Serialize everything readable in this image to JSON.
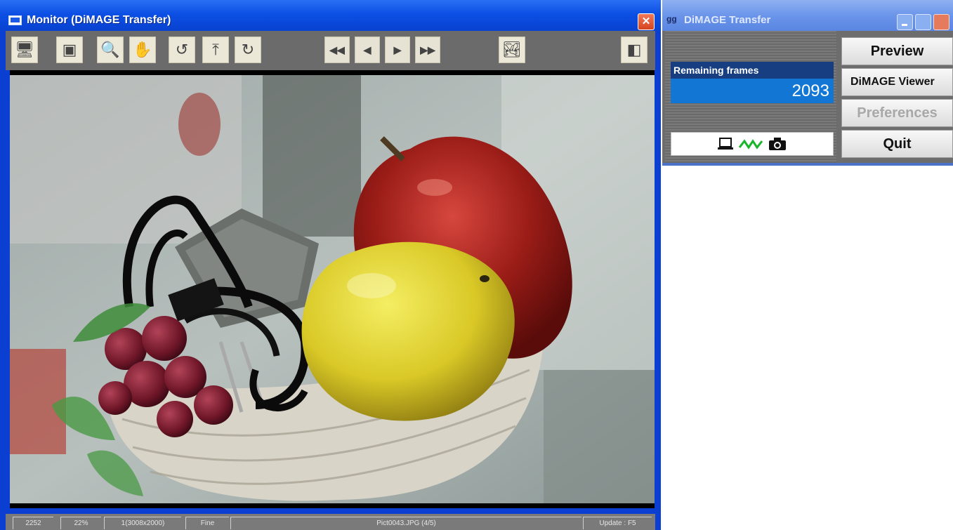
{
  "monitor": {
    "title": "Monitor (DiMAGE Transfer)",
    "close_glyph": "✕",
    "toolbar": {
      "tools": [
        {
          "name": "monitor-view-icon",
          "glyph": "🖥"
        },
        {
          "name": "fit-frame-icon",
          "glyph": "▣"
        },
        {
          "name": "zoom-icon",
          "glyph": "🔍"
        },
        {
          "name": "hand-pan-icon",
          "glyph": "✋"
        },
        {
          "name": "rotate-left-icon",
          "glyph": "↺"
        },
        {
          "name": "upload-icon",
          "glyph": "⤒"
        },
        {
          "name": "rotate-right-icon",
          "glyph": "↻"
        }
      ],
      "nav": [
        "◀◀",
        "◀",
        "▶",
        "▶▶"
      ],
      "image_icon": "🏞",
      "exit_icon": "◧"
    },
    "status": {
      "a": "2252",
      "zoom": "22%",
      "size": "1(3008x2000)",
      "quality": "Fine",
      "file": "Pict0043.JPG (4/5)",
      "update": "Update : F5"
    }
  },
  "transfer": {
    "title": "DiMAGE Transfer",
    "icon_text": "gg",
    "remaining_label": "Remaining frames",
    "remaining_value": "2093",
    "buttons": {
      "preview": "Preview",
      "viewer": "DiMAGE Viewer",
      "preferences": "Preferences",
      "quit": "Quit"
    },
    "conn_icons": [
      "laptop-icon",
      "signal-icon",
      "camera-icon"
    ]
  }
}
